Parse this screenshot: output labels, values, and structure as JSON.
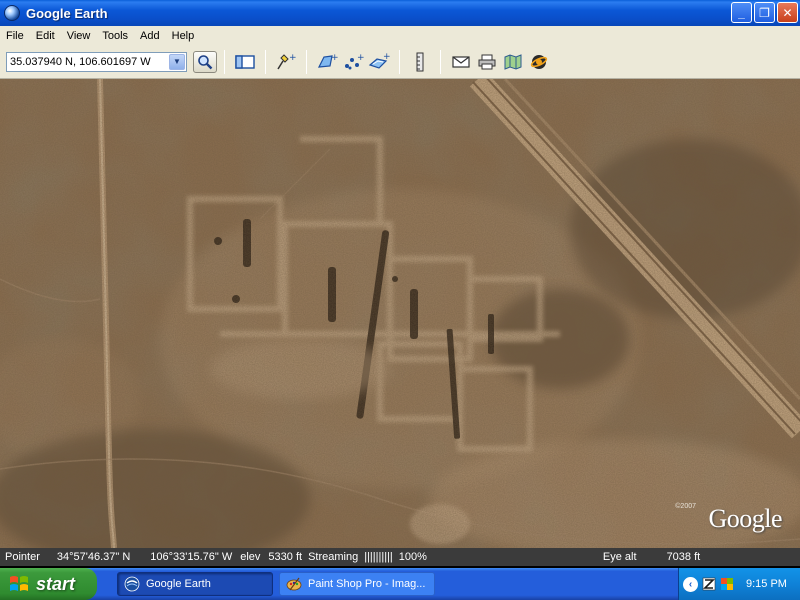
{
  "window": {
    "title": "Google Earth",
    "minimize": "_",
    "maximize": "❐",
    "close": "✕"
  },
  "menu": {
    "items": [
      "File",
      "Edit",
      "View",
      "Tools",
      "Add",
      "Help"
    ]
  },
  "toolbar": {
    "coordinates_value": "35.037940 N, 106.601697 W",
    "dropdown_glyph": "▼"
  },
  "map": {
    "logo": "Google",
    "copyright": "©2007"
  },
  "status": {
    "pointer_label": "Pointer",
    "latitude": "34°57'46.37\" N",
    "longitude": "106°33'15.76\" W",
    "elev_label": "elev",
    "elevation": "5330 ft",
    "streaming_label": "Streaming",
    "streaming_bar": "||||||||||",
    "streaming_percent": "100%",
    "eye_label": "Eye alt",
    "eye_alt": "7038 ft"
  },
  "taskbar": {
    "start_label": "start",
    "tasks": [
      {
        "label": "Google Earth",
        "active": true
      },
      {
        "label": "Paint Shop Pro - Imag...",
        "active": false
      }
    ],
    "tray_chevron": "‹",
    "clock": "9:15 PM"
  },
  "colors": {
    "title_bar": "#0b57d6",
    "chrome": "#ece9d8",
    "status_bar": "#3b3b3b",
    "taskbar": "#245edb",
    "start_button": "#3c9a3c"
  }
}
